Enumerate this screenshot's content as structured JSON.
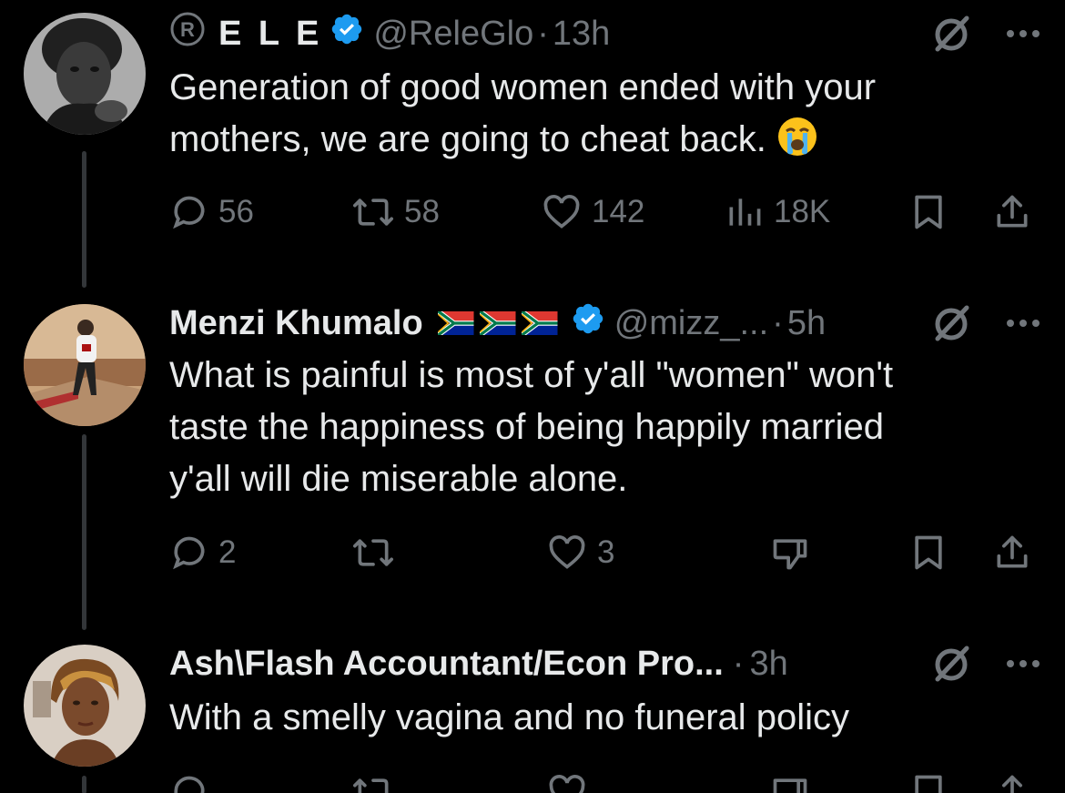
{
  "tweets": [
    {
      "name": "E L E",
      "handle": "@ReleGlo",
      "dot": "·",
      "time": "13h",
      "text_lines": [
        "Generation of good women ended with your",
        "mothers, we are going to cheat back."
      ],
      "emoji_icon": "loudly-crying-face-icon",
      "stats": {
        "replies": "56",
        "reposts": "58",
        "likes": "142",
        "views": "18K"
      }
    },
    {
      "name": "Menzi Khumalo",
      "handle": "@mizz_...",
      "dot": "·",
      "time": "5h",
      "flags_icon": "south-africa-flag-icon",
      "text_lines": [
        "What is painful is most of y'all \"women\" won't",
        "taste the happiness of being happily married",
        "y'all will die miserable alone."
      ],
      "stats": {
        "replies": "2",
        "reposts": "",
        "likes": "3"
      }
    },
    {
      "name": "Ash\\Flash Accountant/Econ Pro...",
      "dot": "·",
      "time": "3h",
      "text_lines": [
        "With a smelly vagina and no funeral policy"
      ]
    }
  ],
  "colors": {
    "background": "#000000",
    "text_primary": "#e7e9ea",
    "text_secondary": "#71767b",
    "verified_blue": "#1d9bf0",
    "thread_line": "#333639"
  }
}
